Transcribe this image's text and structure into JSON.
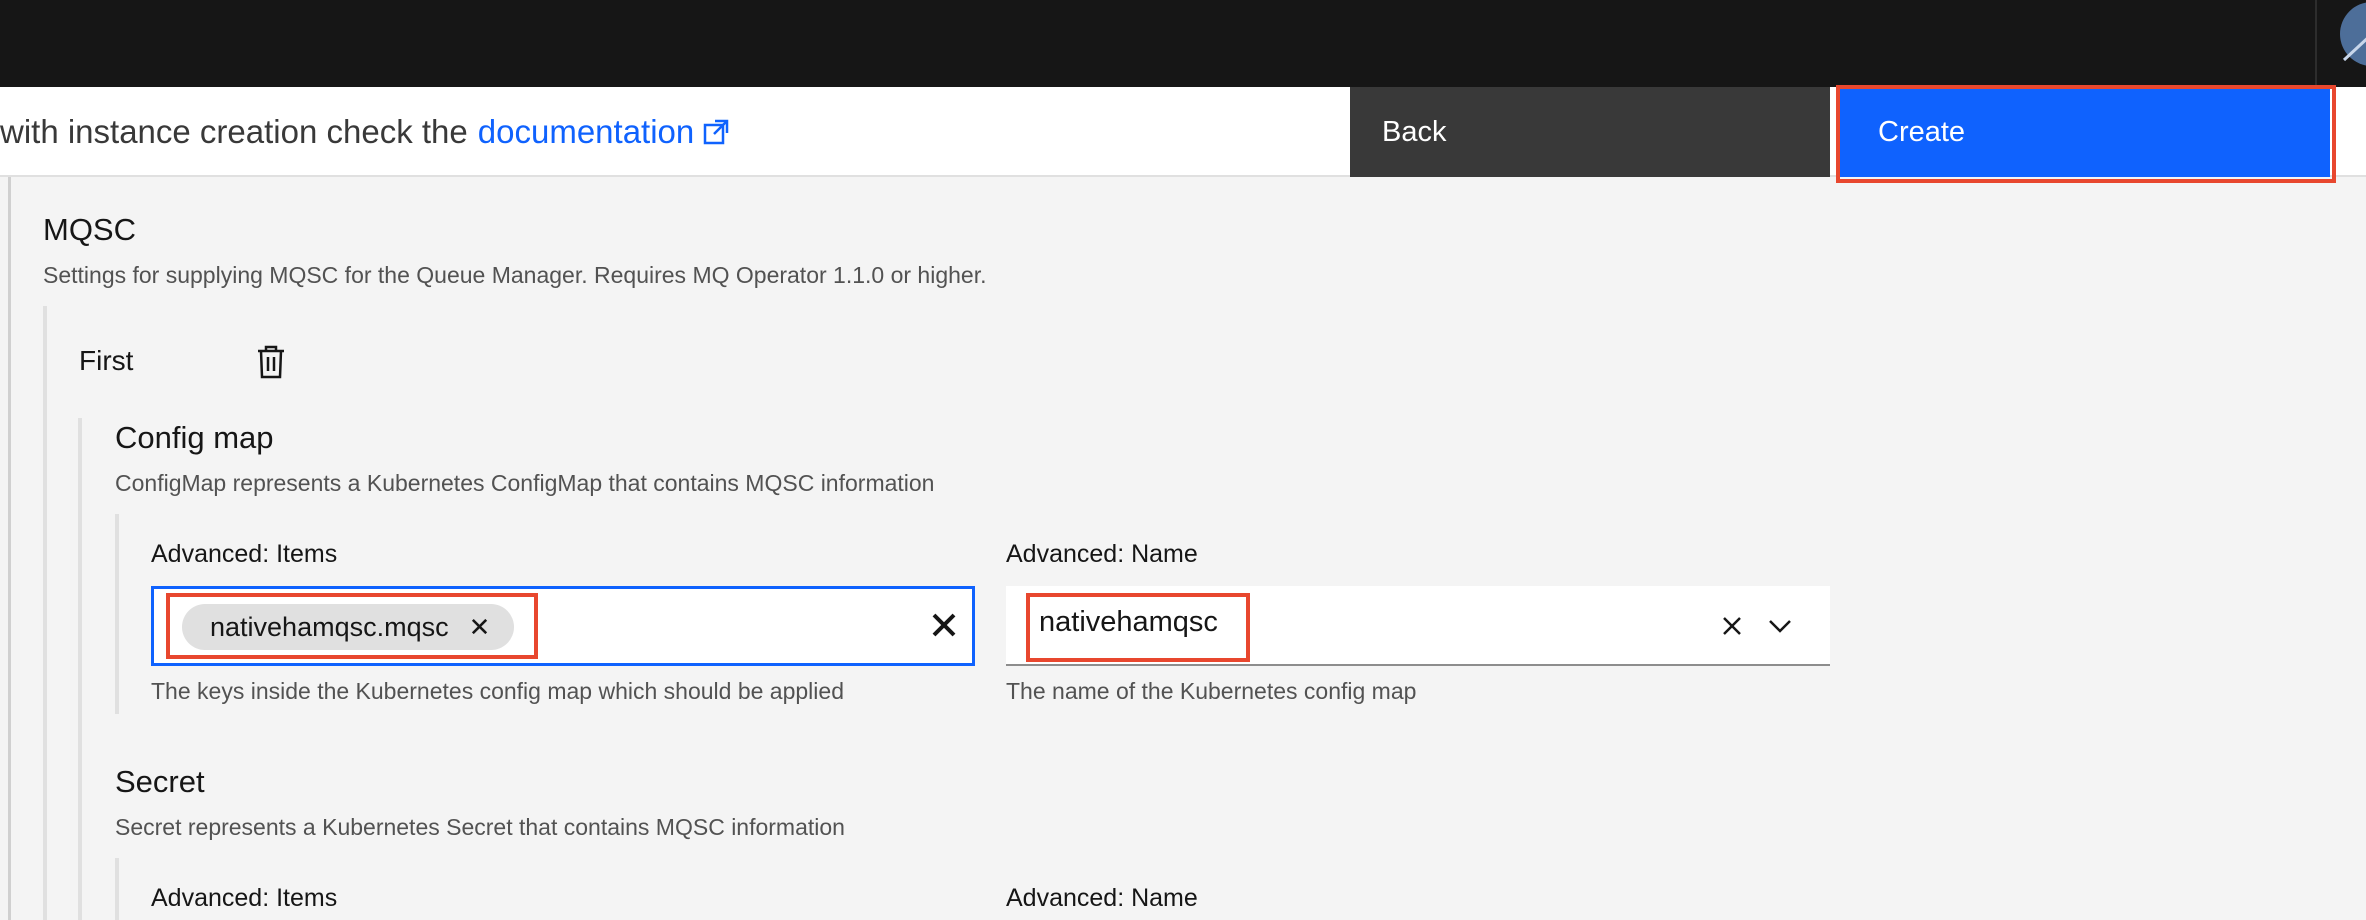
{
  "header": {
    "notice_text": "with instance creation check the",
    "doc_link": "documentation",
    "back_label": "Back",
    "create_label": "Create"
  },
  "mqsc": {
    "title": "MQSC",
    "description": "Settings for supplying MQSC for the Queue Manager. Requires MQ Operator 1.1.0 or higher.",
    "entry_label": "First",
    "config_map": {
      "title": "Config map",
      "description": "ConfigMap represents a Kubernetes ConfigMap that contains MQSC information",
      "items_label": "Advanced: Items",
      "items_tag": "nativehamqsc.mqsc",
      "items_helper": "The keys inside the Kubernetes config map which should be applied",
      "name_label": "Advanced: Name",
      "name_value": "nativehamqsc",
      "name_helper": "The name of the Kubernetes config map"
    },
    "secret": {
      "title": "Secret",
      "description": "Secret represents a Kubernetes Secret that contains MQSC information",
      "items_label": "Advanced: Items",
      "name_label": "Advanced: Name"
    }
  },
  "colors": {
    "primary": "#0f62fe",
    "highlight": "#e8472e",
    "topbar": "#161616",
    "secondary_button": "#393939"
  },
  "icons": {
    "external_link": "external-link-icon",
    "trash": "trash-icon",
    "close": "close-icon",
    "chevron": "chevron-down-icon"
  }
}
